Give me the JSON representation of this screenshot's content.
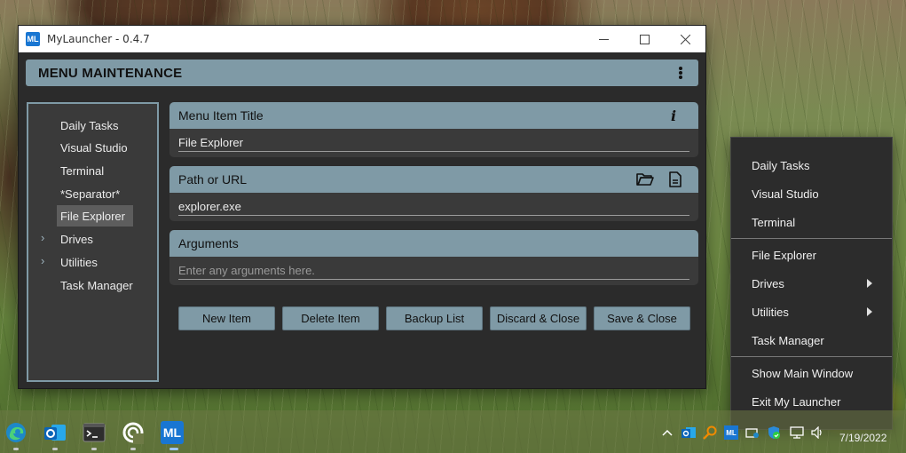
{
  "window": {
    "title": "MyLauncher - 0.4.7",
    "app_icon_text": "ML"
  },
  "header": {
    "title": "MENU MAINTENANCE"
  },
  "sidebar": {
    "items": [
      {
        "label": "Daily Tasks",
        "expandable": false,
        "selected": false
      },
      {
        "label": "Visual Studio",
        "expandable": false,
        "selected": false
      },
      {
        "label": "Terminal",
        "expandable": false,
        "selected": false
      },
      {
        "label": "*Separator*",
        "expandable": false,
        "selected": false
      },
      {
        "label": "File Explorer",
        "expandable": false,
        "selected": true
      },
      {
        "label": "Drives",
        "expandable": true,
        "selected": false
      },
      {
        "label": "Utilities",
        "expandable": true,
        "selected": false
      },
      {
        "label": "Task Manager",
        "expandable": false,
        "selected": false
      }
    ]
  },
  "fields": {
    "title": {
      "label": "Menu Item Title",
      "value": "File Explorer",
      "icon": "info-icon"
    },
    "path": {
      "label": "Path or URL",
      "value": "explorer.exe",
      "icons": [
        "folder-open-icon",
        "file-icon"
      ]
    },
    "arguments": {
      "label": "Arguments",
      "value": "",
      "placeholder": "Enter any arguments here."
    }
  },
  "buttons": {
    "new_item": "New Item",
    "delete_item": "Delete Item",
    "backup_list": "Backup List",
    "discard_close": "Discard & Close",
    "save_close": "Save & Close"
  },
  "context_menu": {
    "group1": [
      "Daily Tasks",
      "Visual Studio",
      "Terminal"
    ],
    "group2": [
      {
        "label": "File Explorer",
        "submenu": false
      },
      {
        "label": "Drives",
        "submenu": true
      },
      {
        "label": "Utilities",
        "submenu": true
      },
      {
        "label": "Task Manager",
        "submenu": false
      }
    ],
    "group3": [
      "Show Main Window",
      "Exit My Launcher"
    ]
  },
  "taskbar": {
    "apps": [
      "edge-icon",
      "outlook-icon",
      "terminal-icon",
      "cortana-icon",
      "mylauncher-icon"
    ],
    "mylauncher_text": "ML",
    "tray": [
      "chevron-up-icon",
      "outlook-tray-icon",
      "search-tray-icon",
      "mylauncher-tray-icon",
      "network-tray-icon",
      "security-tray-icon",
      "display-tray-icon",
      "volume-icon"
    ],
    "tray_ml_text": "ML",
    "date": "7/19/2022"
  },
  "colors": {
    "accent": "#7f9aa6",
    "window_bg": "#2b2b2b",
    "panel_bg": "#3a3a3a"
  }
}
